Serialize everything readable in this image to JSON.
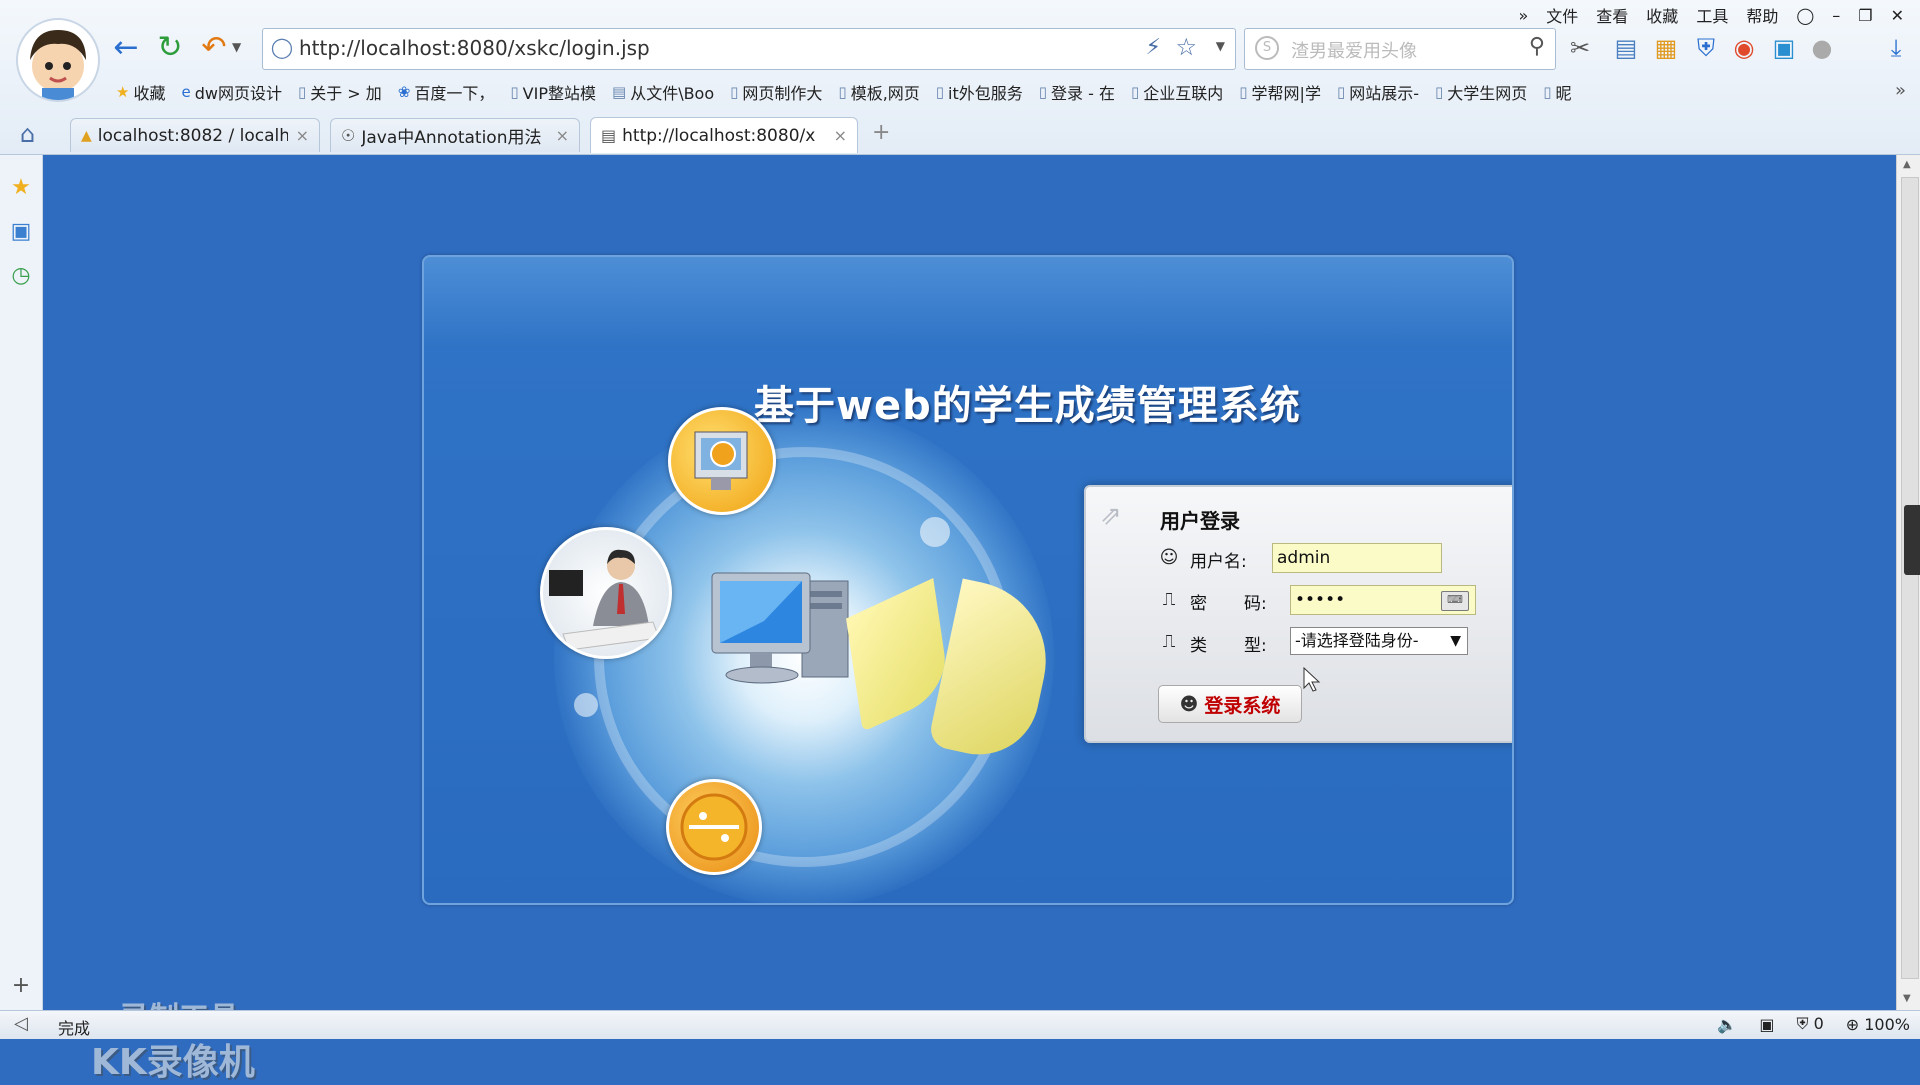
{
  "browser": {
    "menu": [
      "文件",
      "查看",
      "收藏",
      "工具",
      "帮助"
    ],
    "menu_more": "»",
    "address": "http://localhost:8080/xskc/login.jsp",
    "search_placeholder": "渣男最爱用头像",
    "bookmarks": [
      {
        "label": "收藏",
        "icon": "star-icon"
      },
      {
        "label": "dw网页设计",
        "icon": "e-icon"
      },
      {
        "label": "关于 > 加",
        "icon": "page-icon"
      },
      {
        "label": "百度一下，",
        "icon": "paw-icon"
      },
      {
        "label": "VIP整站模",
        "icon": "page-icon"
      },
      {
        "label": "从文件\\Boo",
        "icon": "folder-icon"
      },
      {
        "label": "网页制作大",
        "icon": "page-icon"
      },
      {
        "label": "模板,网页",
        "icon": "page-icon"
      },
      {
        "label": "it外包服务",
        "icon": "page-icon"
      },
      {
        "label": "登录 - 在",
        "icon": "page-icon"
      },
      {
        "label": "企业互联内",
        "icon": "page-icon"
      },
      {
        "label": "学帮网|学",
        "icon": "page-icon"
      },
      {
        "label": "网站展示-",
        "icon": "page-icon"
      },
      {
        "label": "大学生网页",
        "icon": "page-icon"
      },
      {
        "label": "昵",
        "icon": "page-icon"
      }
    ],
    "tabs": [
      {
        "label": "localhost:8082 / localh",
        "active": false
      },
      {
        "label": "Java中Annotation用法",
        "active": false
      },
      {
        "label": "http://localhost:8080/x",
        "active": true
      }
    ],
    "status_text": "完成",
    "status_counter": "0",
    "zoom": "100%"
  },
  "page": {
    "title": "基于web的学生成绩管理系统",
    "login": {
      "heading": "用户登录",
      "username_label": "用户名:",
      "username_value": "admin",
      "password_label_1": "密",
      "password_label_2": "码:",
      "password_value": "•••••",
      "type_label_1": "类",
      "type_label_2": "型:",
      "type_value": "-请选择登陆身份-",
      "submit_label": "登录系统"
    }
  },
  "watermark": {
    "line1": "录制工具",
    "line2": "KK录像机"
  },
  "colors": {
    "page_bg": "#2f6cc0",
    "field_bg": "#fbfbc8",
    "button_text": "#c00000"
  }
}
